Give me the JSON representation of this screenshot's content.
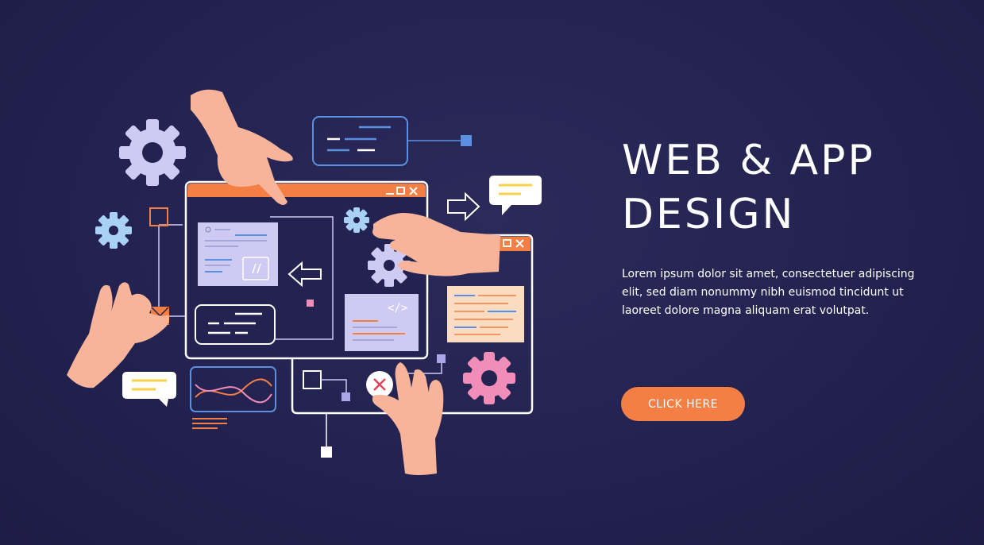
{
  "hero": {
    "title_line1": "WEB & APP",
    "title_line2": "DESIGN",
    "description": "Lorem ipsum dolor sit amet, consectetuer adipiscing elit, sed diam nonummy nibh euismod tincidunt ut laoreet dolore magna aliquam erat volutpat.",
    "cta_label": "CLICK HERE"
  },
  "illustration": {
    "code_tag": "</>"
  },
  "colors": {
    "background": "#232250",
    "accent": "#f47f45",
    "skin": "#f8b49a",
    "lavender": "#cfcaf2",
    "blue": "#5b8fe0",
    "pink": "#f08db8",
    "yellow": "#f7d24a"
  }
}
